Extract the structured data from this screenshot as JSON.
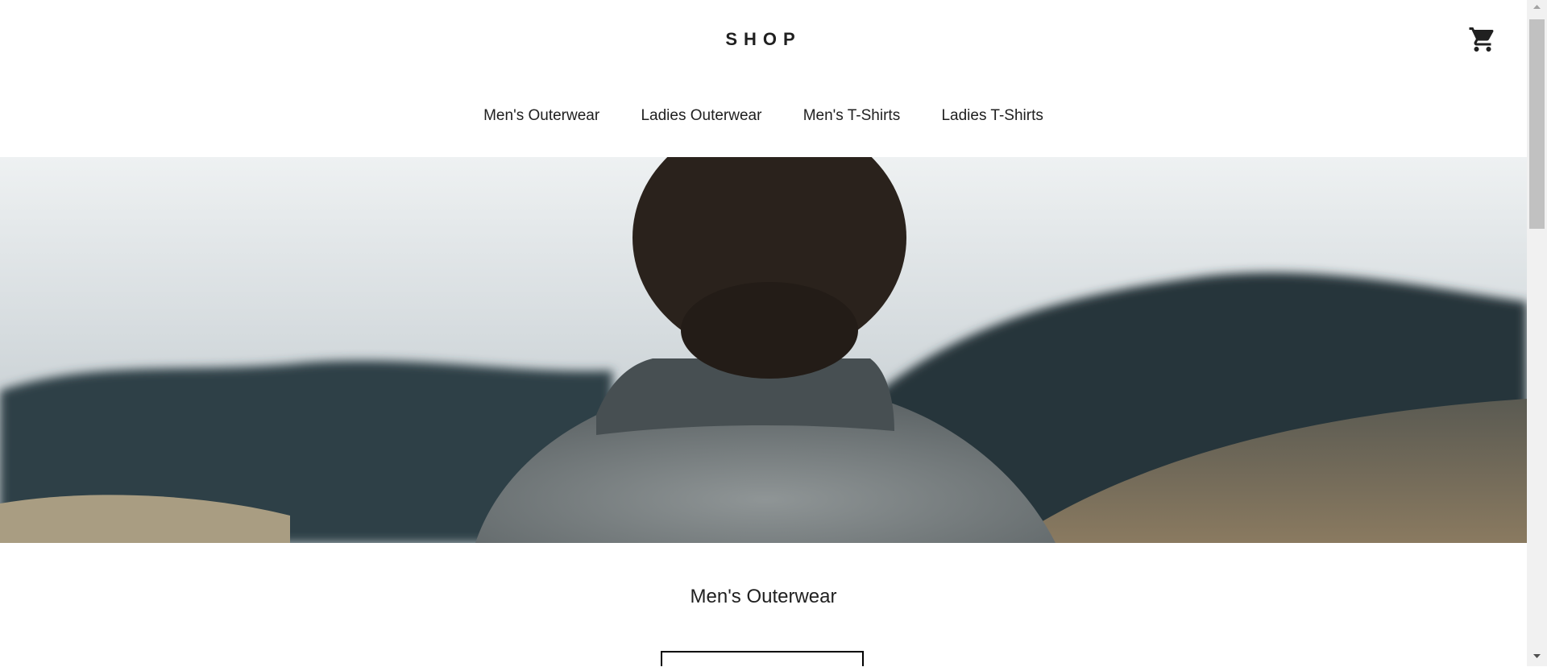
{
  "header": {
    "logo": "SHOP",
    "cart_icon": "cart-icon"
  },
  "nav": {
    "items": [
      {
        "label": "Men's Outerwear"
      },
      {
        "label": "Ladies Outerwear"
      },
      {
        "label": "Men's T-Shirts"
      },
      {
        "label": "Ladies T-Shirts"
      }
    ]
  },
  "hero": {
    "image": "man-in-grey-sweater-facing-misty-forest"
  },
  "section": {
    "title": "Men's Outerwear"
  },
  "colors": {
    "text": "#202020",
    "background": "#ffffff"
  }
}
